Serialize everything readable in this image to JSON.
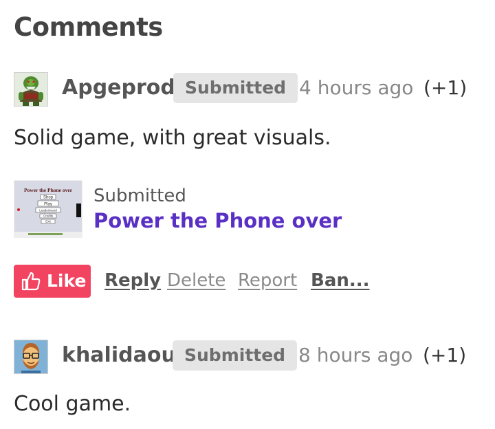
{
  "page": {
    "title": "Comments"
  },
  "comments": [
    {
      "author": "Apgeprod",
      "badge": "Submitted",
      "time": "4 hours ago",
      "score": "(+1)",
      "body": "Solid game, with great visuals.",
      "avatar_icon": "green-orc-avatar",
      "attachment": {
        "kind": "Submitted",
        "title": "Power the Phone over",
        "thumb_title": "Power the Phone over",
        "thumb_buttons": [
          "Shop",
          "Play",
          "Leaderboard",
          "Credits",
          "Exit"
        ]
      },
      "actions": {
        "like": "Like",
        "reply": "Reply",
        "delete": "Delete",
        "report": "Report",
        "ban": "Ban..."
      }
    },
    {
      "author": "khalidaou",
      "badge": "Submitted",
      "time": "8 hours ago",
      "score": "(+1)",
      "body": "Cool game.",
      "avatar_icon": "bearded-man-glasses-avatar"
    }
  ],
  "colors": {
    "like": "#f24461",
    "link": "#5a2fc4",
    "badge_bg": "#e5e5e5"
  },
  "icons": {
    "like": "thumbs-up-icon"
  }
}
